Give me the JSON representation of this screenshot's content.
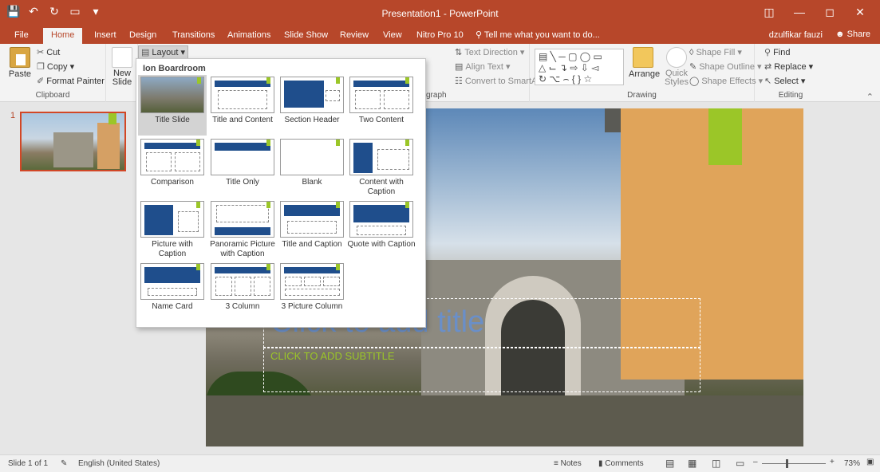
{
  "window": {
    "title": "Presentation1 - PowerPoint",
    "qat_icons": [
      "save-icon",
      "undo-icon",
      "redo-icon",
      "start-from-beginning-icon",
      "customize-qat-icon"
    ],
    "controls": [
      "ribbon-display-options-icon",
      "minimize-icon",
      "restore-icon",
      "close-icon"
    ]
  },
  "tabs": [
    "File",
    "Home",
    "Insert",
    "Design",
    "Transitions",
    "Animations",
    "Slide Show",
    "Review",
    "View",
    "Nitro Pro 10"
  ],
  "active_tab": "Home",
  "tell_me": "Tell me what you want to do...",
  "user": "dzulfikar fauzi",
  "share": "Share",
  "ribbon": {
    "clipboard": {
      "paste": "Paste",
      "cut": "Cut",
      "copy": "Copy",
      "format_painter": "Format Painter",
      "label": "Clipboard"
    },
    "slides": {
      "new_slide": "New Slide",
      "layout": "Layout"
    },
    "paragraph": {
      "text_direction": "Text Direction",
      "align_text": "Align Text",
      "convert_smartart": "Convert to SmartArt",
      "label": "graph"
    },
    "drawing": {
      "arrange": "Arrange",
      "quick_styles": "Quick Styles",
      "shape_fill": "Shape Fill",
      "shape_outline": "Shape Outline",
      "shape_effects": "Shape Effects",
      "label": "Drawing"
    },
    "editing": {
      "find": "Find",
      "replace": "Replace",
      "select": "Select",
      "label": "Editing"
    }
  },
  "layout_menu": {
    "theme": "Ion Boardroom",
    "selected": "Title Slide",
    "items": [
      "Title Slide",
      "Title and Content",
      "Section Header",
      "Two Content",
      "Comparison",
      "Title Only",
      "Blank",
      "Content with Caption",
      "Picture with Caption",
      "Panoramic Picture with Caption",
      "Title and Caption",
      "Quote with Caption",
      "Name Card",
      "3 Column",
      "3 Picture Column"
    ]
  },
  "slides_pane": {
    "slide_number": "1"
  },
  "slide": {
    "title_placeholder": "Click to add title",
    "subtitle_placeholder": "CLICK TO ADD SUBTITLE"
  },
  "status": {
    "slide_info": "Slide 1 of 1",
    "language": "English (United States)",
    "notes": "Notes",
    "comments": "Comments",
    "zoom": "73%"
  },
  "colors": {
    "accent": "#b7472a",
    "ion_blue": "#1f4e8c",
    "ion_green": "#9bc628"
  }
}
